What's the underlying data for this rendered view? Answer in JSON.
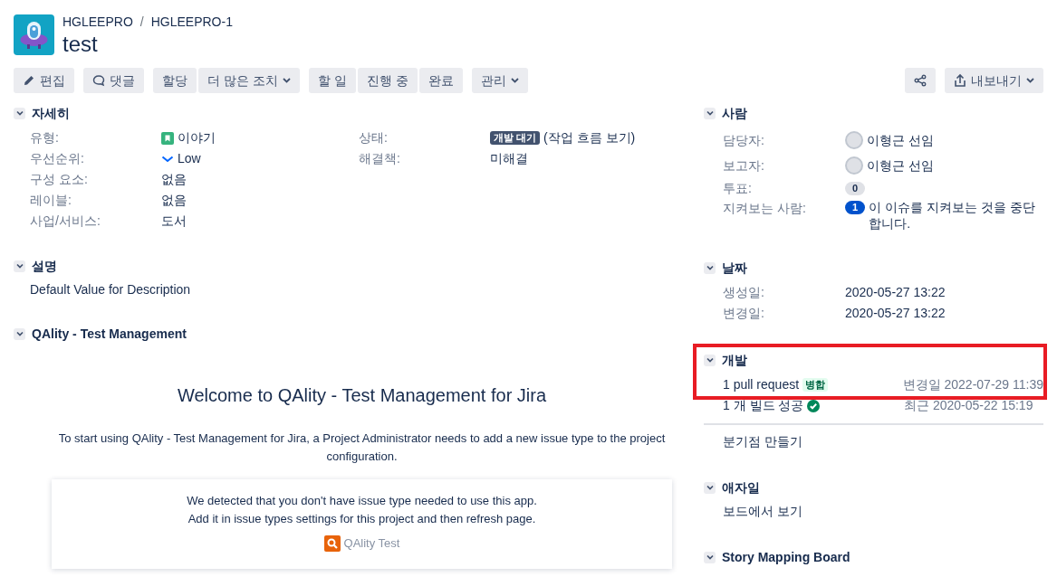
{
  "breadcrumbs": [
    "HGLEEPRO",
    "HGLEEPRO-1"
  ],
  "breadcrumb_separator": "/",
  "title": "test",
  "toolbar": {
    "left": [
      [
        {
          "label": "편집",
          "kind": "edit",
          "dropdown": false
        }
      ],
      [
        {
          "label": "댓글",
          "kind": "comment",
          "dropdown": false
        }
      ],
      [
        {
          "label": "할당",
          "kind": "plain",
          "dropdown": false
        },
        {
          "label": "더 많은 조치",
          "kind": "plain",
          "dropdown": true
        }
      ],
      [
        {
          "label": "할 일",
          "kind": "plain",
          "dropdown": false
        },
        {
          "label": "진행 중",
          "kind": "plain",
          "dropdown": false
        },
        {
          "label": "완료",
          "kind": "plain",
          "dropdown": false
        }
      ],
      [
        {
          "label": "관리",
          "kind": "plain",
          "dropdown": true
        }
      ]
    ],
    "right": [
      [
        {
          "kind": "share",
          "dropdown": false
        }
      ],
      [
        {
          "label": "내보내기",
          "kind": "export",
          "dropdown": true
        }
      ]
    ]
  },
  "details": {
    "heading": "자세히",
    "expanded": true,
    "left": [
      {
        "label": "유형:",
        "value": "이야기",
        "kind": "story"
      },
      {
        "label": "우선순위:",
        "value": "Low",
        "kind": "priority"
      },
      {
        "label": "구성 요소:",
        "value": "없음",
        "kind": "plain"
      },
      {
        "label": "레이블:",
        "value": "없음",
        "kind": "plain"
      },
      {
        "label": "사업/서비스:",
        "value": "도서",
        "kind": "plain"
      }
    ],
    "right": [
      {
        "label": "상태:",
        "badge": "개발 대기",
        "link": "(작업 흐름 보기)",
        "kind": "status"
      },
      {
        "label": "해결책:",
        "value": "미해결",
        "kind": "plain"
      }
    ]
  },
  "description": {
    "heading": "설명",
    "expanded": true,
    "text": "Default Value for Description"
  },
  "qality": {
    "heading": "QAlity - Test Management",
    "expanded": true,
    "welcome": "Welcome to QAlity - Test Management for Jira",
    "intro": "To start using QAlity - Test Management for Jira, a Project Administrator needs to add a new issue type to the project configuration.",
    "notice": [
      "We detected that you don't have issue type needed to use this app.",
      "Add it in issue types settings for this project and then refresh page."
    ],
    "app_link": "QAlity Test"
  },
  "people": {
    "heading": "사람",
    "expanded": true,
    "fields": [
      {
        "label": "담당자:",
        "kind": "user",
        "value": "이형근 선임"
      },
      {
        "label": "보고자:",
        "kind": "user",
        "value": "이형근 선임"
      },
      {
        "label": "투표:",
        "kind": "count",
        "count": "0"
      },
      {
        "label": "지켜보는 사람:",
        "kind": "watch",
        "count": "1",
        "link": "이 이슈를 지켜보는 것을 중단합니다."
      }
    ]
  },
  "dates": {
    "heading": "날짜",
    "expanded": true,
    "fields": [
      {
        "label": "생성일:",
        "value": "2020-05-27 13:22"
      },
      {
        "label": "변경일:",
        "value": "2020-05-27 13:22"
      }
    ]
  },
  "development": {
    "heading": "개발",
    "expanded": true,
    "highlighted": true,
    "items": [
      {
        "kind": "pr",
        "link": "1 pull request",
        "tag": "병합",
        "meta": "변경일 2022-07-29 11:39"
      },
      {
        "kind": "build",
        "link": "1 개 빌드 성공",
        "meta": "최근 2020-05-22 15:19"
      }
    ],
    "create_branch": "분기점 만들기"
  },
  "agile": {
    "heading": "애자일",
    "expanded": true,
    "link": "보드에서 보기"
  },
  "story_mapping": {
    "heading": "Story Mapping Board",
    "expanded": true
  }
}
